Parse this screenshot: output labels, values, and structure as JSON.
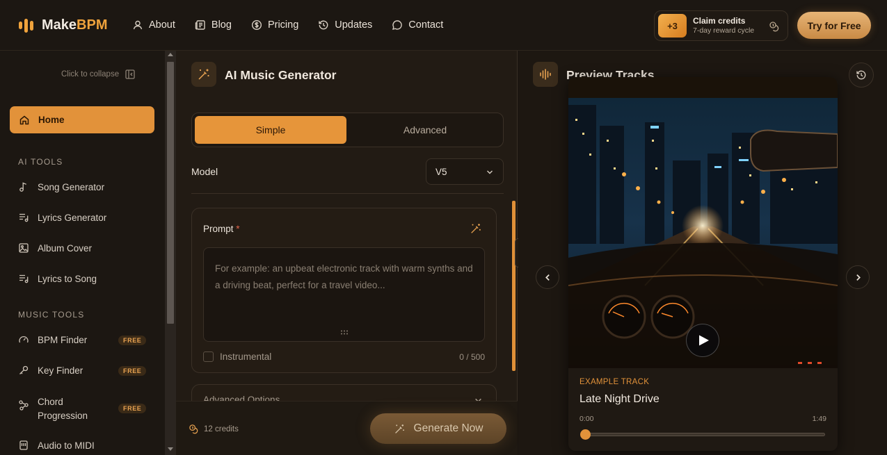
{
  "brand": {
    "name_main": "Make",
    "name_accent": "BPM"
  },
  "nav": [
    {
      "label": "About",
      "icon": "user-icon"
    },
    {
      "label": "Blog",
      "icon": "news-icon"
    },
    {
      "label": "Pricing",
      "icon": "dollar-icon"
    },
    {
      "label": "Updates",
      "icon": "history-icon"
    },
    {
      "label": "Contact",
      "icon": "chat-icon"
    }
  ],
  "claim": {
    "badge": "+3",
    "title": "Claim credits",
    "subtitle": "7-day reward cycle"
  },
  "try_button": "Try for Free",
  "sidebar": {
    "collapse_label": "Click to collapse",
    "home": "Home",
    "ai_tools_title": "AI TOOLS",
    "ai_tools": [
      "Song Generator",
      "Lyrics Generator",
      "Album Cover",
      "Lyrics to Song"
    ],
    "music_tools_title": "MUSIC TOOLS",
    "music_tools": [
      {
        "label": "BPM Finder",
        "badge": "FREE"
      },
      {
        "label": "Key Finder",
        "badge": "FREE"
      },
      {
        "label": "Chord Progression",
        "badge": "FREE"
      },
      {
        "label": "Audio to MIDI"
      }
    ]
  },
  "generator": {
    "title": "AI Music Generator",
    "modes": [
      "Simple",
      "Advanced"
    ],
    "active_mode": "Simple",
    "model_label": "Model",
    "model_value": "V5",
    "prompt_label": "Prompt",
    "prompt_required": "*",
    "prompt_placeholder": "For example: an upbeat electronic track with warm synths and a driving beat, perfect for a travel video...",
    "instrumental_label": "Instrumental",
    "instrumental_checked": false,
    "char_count": "0 / 500",
    "advanced_options_label": "Advanced Options",
    "credits": "12 credits",
    "generate_button": "Generate Now"
  },
  "preview": {
    "title": "Preview Tracks",
    "track_tag": "EXAMPLE TRACK",
    "track_name": "Late Night Drive",
    "time_current": "0:00",
    "time_total": "1:49",
    "progress": 0
  },
  "colors": {
    "accent": "#e2923a",
    "background": "#1a1510",
    "panel": "#221b14"
  }
}
